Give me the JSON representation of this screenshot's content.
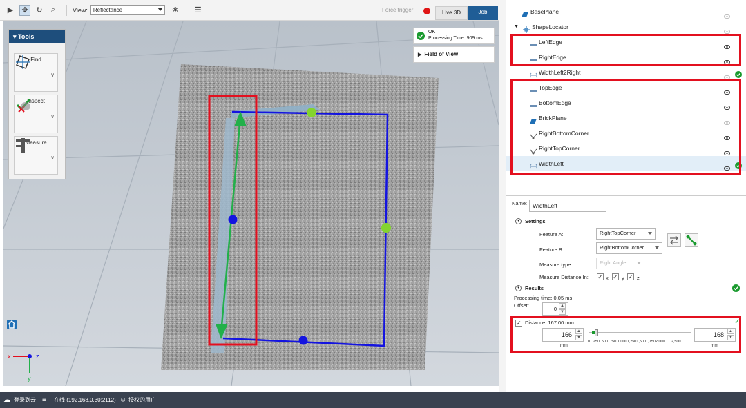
{
  "toolbar": {
    "view_label": "View:",
    "view_value": "Reflectance",
    "force_trigger": "Force trigger",
    "tabs": [
      {
        "label": "Live 3D"
      },
      {
        "label": "Job"
      }
    ],
    "active_tab": "Job"
  },
  "viewport": {
    "tools_panel": {
      "title": "Tools",
      "items": [
        {
          "label": "Find"
        },
        {
          "label": "Inspect"
        },
        {
          "label": "Measure"
        }
      ]
    },
    "status": {
      "ok": "OK",
      "processing": "Processing Time: 909 ms"
    },
    "field_of_view": "Field of View",
    "axes": {
      "x": "x",
      "y": "y",
      "z": "z"
    }
  },
  "tree": {
    "items": [
      {
        "label": "BasePlane",
        "icon": "plane-icon",
        "indent": 1
      },
      {
        "label": "ShapeLocator",
        "icon": "locator-icon",
        "indent": 0,
        "expanded": true
      },
      {
        "label": "LeftEdge",
        "icon": "edge-icon",
        "indent": 2
      },
      {
        "label": "RightEdge",
        "icon": "edge-icon",
        "indent": 2
      },
      {
        "label": "WidthLeft2Right",
        "icon": "width-icon",
        "indent": 2,
        "ok": true
      },
      {
        "label": "TopEdge",
        "icon": "edge-icon",
        "indent": 2
      },
      {
        "label": "BottomEdge",
        "icon": "edge-icon",
        "indent": 2
      },
      {
        "label": "BrickPlane",
        "icon": "plane-icon",
        "indent": 2
      },
      {
        "label": "RightBottomCorner",
        "icon": "corner-icon",
        "indent": 2
      },
      {
        "label": "RightTopCorner",
        "icon": "corner-icon",
        "indent": 2
      },
      {
        "label": "WidthLeft",
        "icon": "width-icon",
        "indent": 2,
        "ok": true,
        "selected": true
      }
    ]
  },
  "properties": {
    "name_label": "Name:",
    "name_value": "WidthLeft",
    "settings_label": "Settings",
    "feature_a_label": "Feature A:",
    "feature_a_value": "RightTopCorner",
    "feature_b_label": "Feature B:",
    "feature_b_value": "RightBottomCorner",
    "measure_type_label": "Measure type:",
    "measure_type_value": "Right Angle",
    "measure_in_label": "Measure Distance In:",
    "axes": [
      "x",
      "y",
      "z"
    ],
    "results_label": "Results",
    "processing_time": "Processing time: 0.05 ms",
    "offset_label": "Offset:",
    "offset_value": "0",
    "distance_label": "Distance: 167.00 mm",
    "min_value": "166",
    "max_value": "168",
    "unit": "mm",
    "scale_ticks": "0   250  500  750 1,0001,2501,5001,7502,000      2,500",
    "slider_low_fraction": 0.066,
    "slider_high_fraction": 0.067
  },
  "statusbar": {
    "cloud": "登录到云",
    "online": "在线 (192.168.0.30:2112)",
    "user": "授权的用户"
  },
  "colors": {
    "accent": "#1f5d96",
    "highlight": "#e3101f",
    "ok_green": "#1a9a2e",
    "bbox_blue": "#1414e0",
    "arrow_green": "#22b04a",
    "handle_lime": "#84d42e"
  }
}
